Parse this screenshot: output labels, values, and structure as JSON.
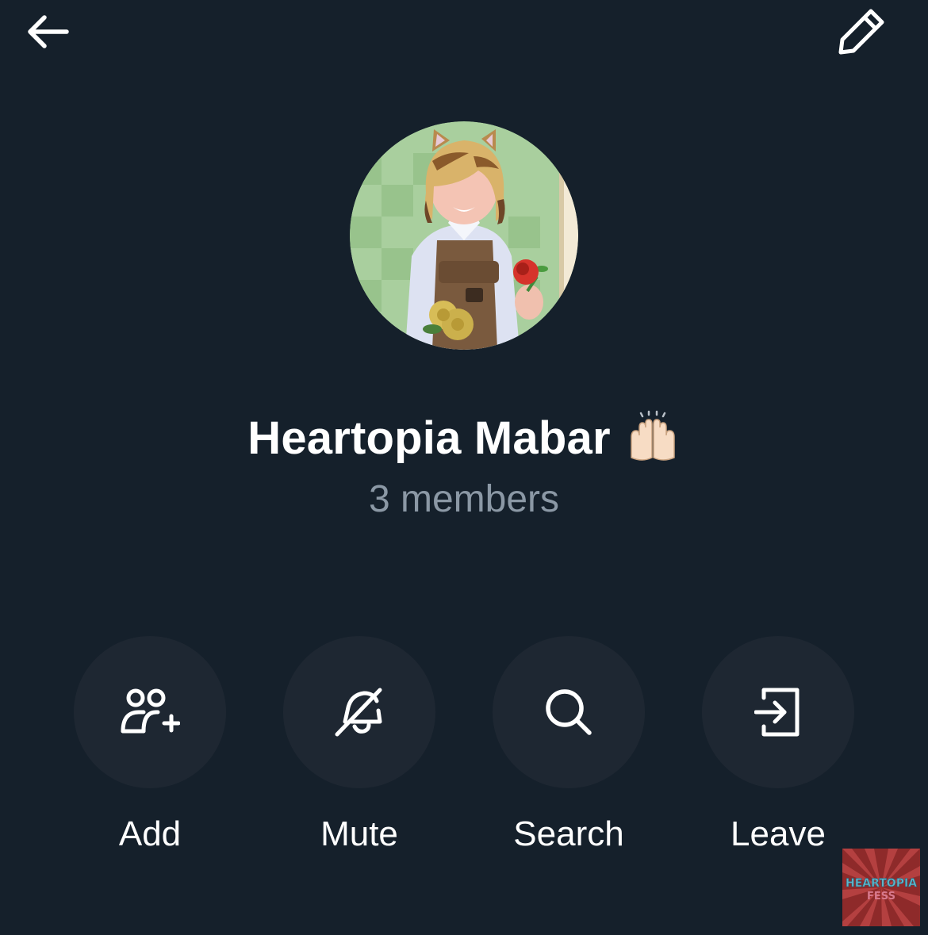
{
  "header": {
    "back_icon": "arrow-left-icon",
    "edit_icon": "pencil-icon"
  },
  "group": {
    "name": "Heartopia Mabar",
    "emoji": "raising-hands-emoji",
    "members_text": "3 members"
  },
  "actions": [
    {
      "label": "Add",
      "icon": "add-people-icon"
    },
    {
      "label": "Mute",
      "icon": "bell-slash-icon"
    },
    {
      "label": "Search",
      "icon": "search-icon"
    },
    {
      "label": "Leave",
      "icon": "leave-icon"
    }
  ],
  "watermark": {
    "line1": "HEARTOPIA",
    "line2": "FESS"
  },
  "colors": {
    "background": "#15202b",
    "action_circle": "#1e2732",
    "secondary_text": "#8b98a5",
    "primary_text": "#ffffff"
  }
}
